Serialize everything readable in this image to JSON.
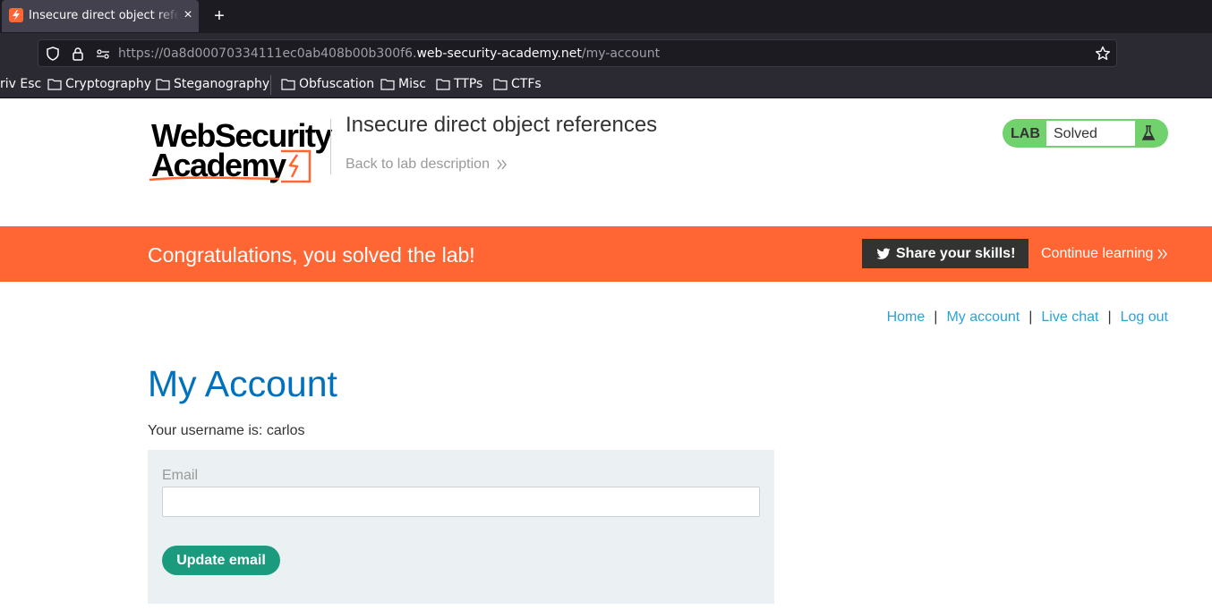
{
  "browser": {
    "tab_title": "Insecure direct object references",
    "tab_close": "×",
    "new_tab": "+",
    "url_prefix": "https://0a8d00070334111ec0ab408b00b300f6.",
    "url_host": "web-security-academy.net",
    "url_path": "/my-account",
    "bookmarks": [
      "riv Esc",
      "Cryptography",
      "Steganography",
      "Obfuscation",
      "Misc",
      "TTPs",
      "CTFs"
    ]
  },
  "header": {
    "logo_line1": "WebSecurity",
    "logo_line2": "Academy",
    "lab_title": "Insecure direct object references",
    "back_link": "Back to lab description",
    "lab_label": "LAB",
    "lab_status": "Solved"
  },
  "banner": {
    "message": "Congratulations, you solved the lab!",
    "share_label": "Share your skills!",
    "continue_label": "Continue learning"
  },
  "nav": {
    "home": "Home",
    "my_account": "My account",
    "live_chat": "Live chat",
    "log_out": "Log out",
    "separator": "|"
  },
  "account": {
    "title": "My Account",
    "username_line": "Your username is: carlos",
    "email_label": "Email",
    "email_value": "",
    "update_button": "Update email"
  },
  "colors": {
    "accent_orange": "#ff6633",
    "link_blue": "#29a3d6",
    "heading_blue": "#0071bc",
    "solved_green": "#70d16d",
    "button_green": "#1a9b7e"
  }
}
